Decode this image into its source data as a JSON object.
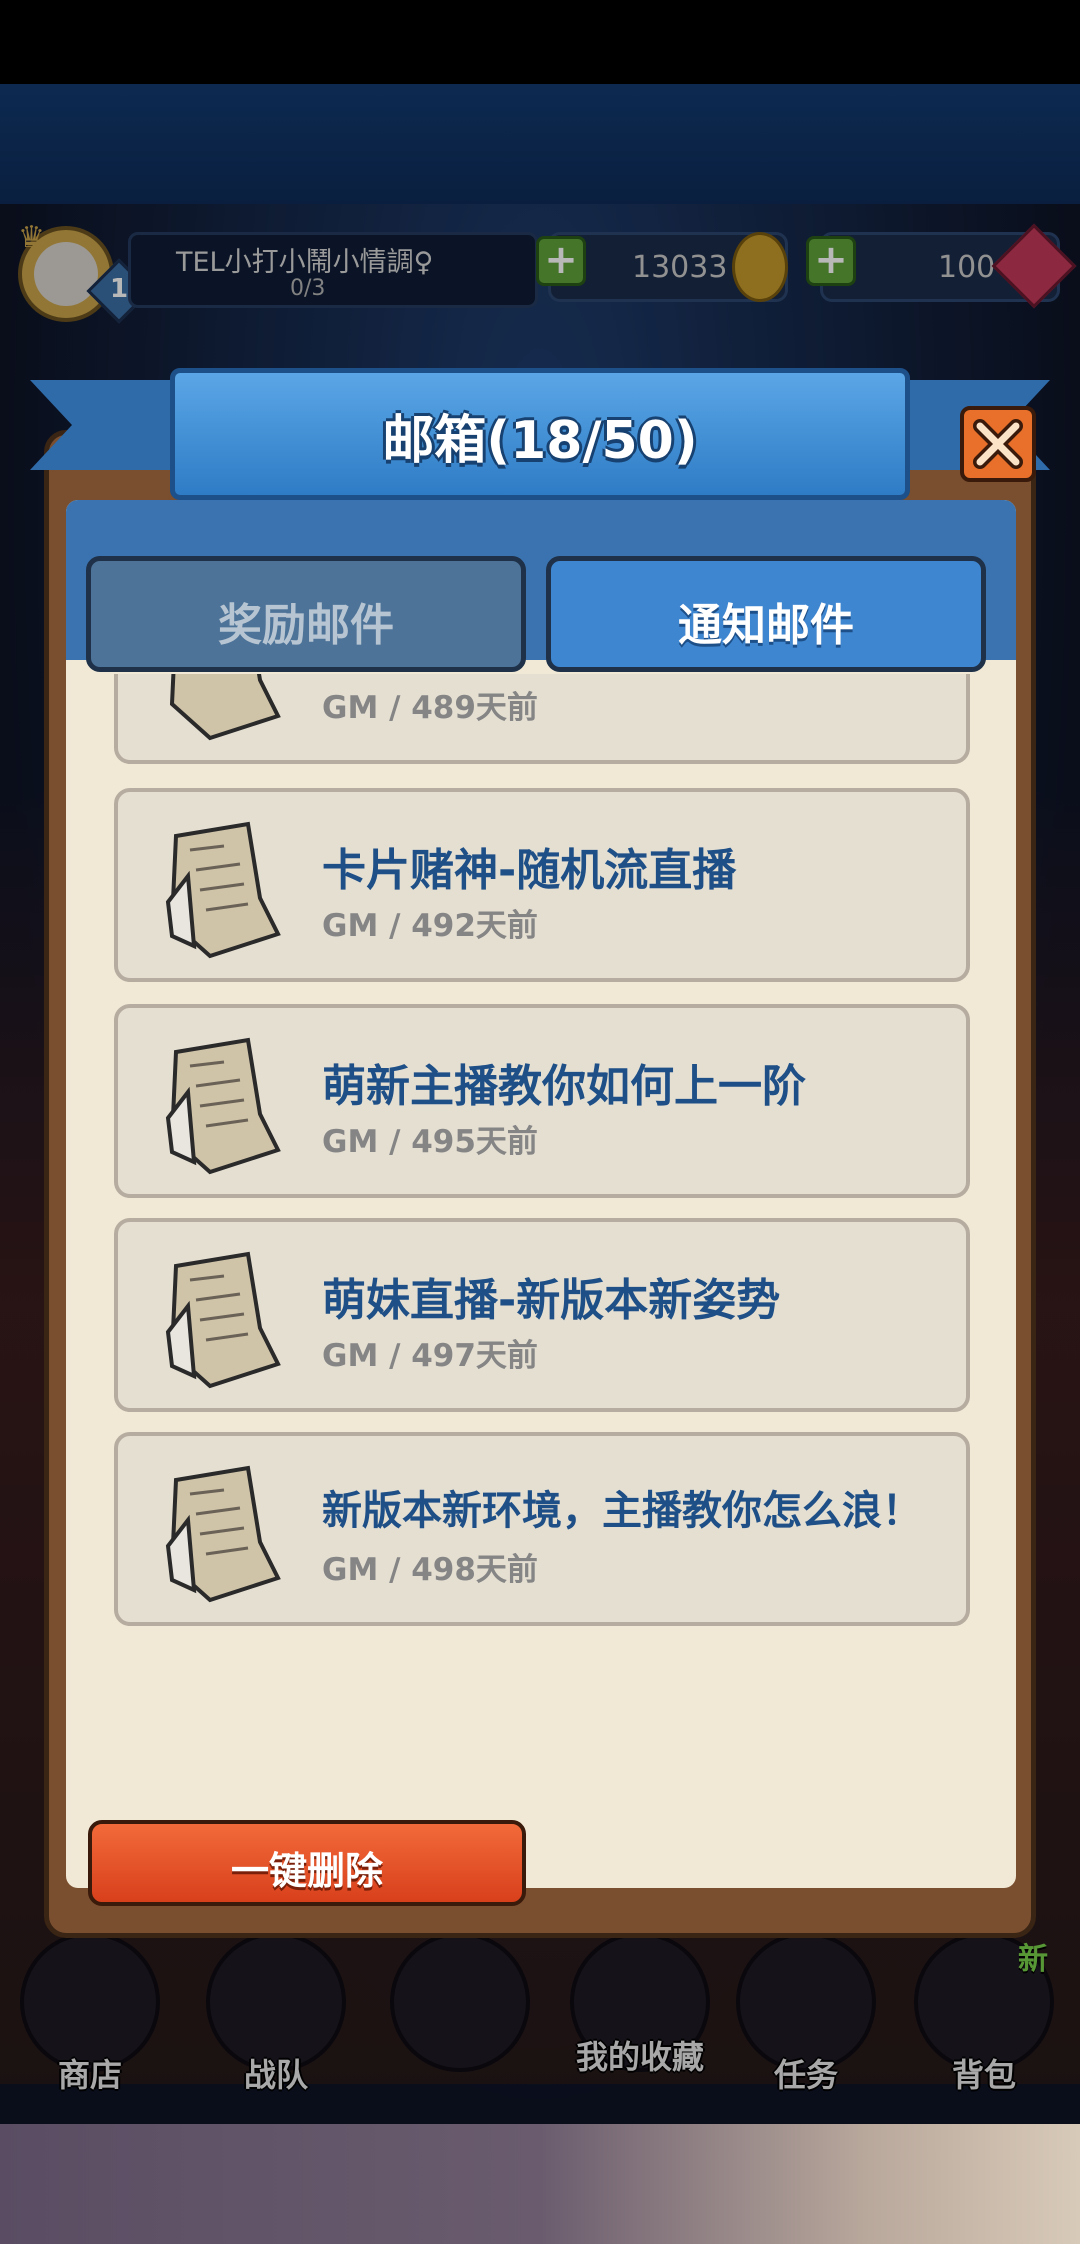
{
  "player": {
    "name": "TEL小打小鬧小情調♀",
    "level": "1",
    "exp": "0/3"
  },
  "currency": {
    "gold": "13033",
    "gems": "100"
  },
  "mailbox": {
    "title": "邮箱(18/50)",
    "tabs": [
      {
        "label": "奖励邮件",
        "active": false
      },
      {
        "label": "通知邮件",
        "active": true
      }
    ],
    "mails": [
      {
        "title": "",
        "meta": "GM / 489天前"
      },
      {
        "title": "卡片赌神-随机流直播",
        "meta": "GM / 492天前"
      },
      {
        "title": "萌新主播教你如何上一阶",
        "meta": "GM / 495天前"
      },
      {
        "title": "萌妹直播-新版本新姿势",
        "meta": "GM / 497天前"
      },
      {
        "title": "新版本新环境，主播教你怎么浪！",
        "meta": "GM / 498天前"
      }
    ],
    "delete_all_label": "一键删除"
  },
  "bottom_nav": {
    "items": [
      {
        "label": "商店",
        "icon": "shop-icon"
      },
      {
        "label": "战队",
        "icon": "team-icon"
      },
      {
        "label": "",
        "icon": "battle-icon"
      },
      {
        "label": "我的收藏",
        "icon": "collection-icon"
      },
      {
        "label": "任务",
        "icon": "quest-icon"
      },
      {
        "label": "背包",
        "icon": "bag-icon"
      }
    ],
    "new_badge": "新"
  },
  "colors": {
    "banner_blue": "#2f7cc6",
    "mail_title": "#1e4f86",
    "delete_button": "#e8522a",
    "close_button": "#e8702a"
  }
}
